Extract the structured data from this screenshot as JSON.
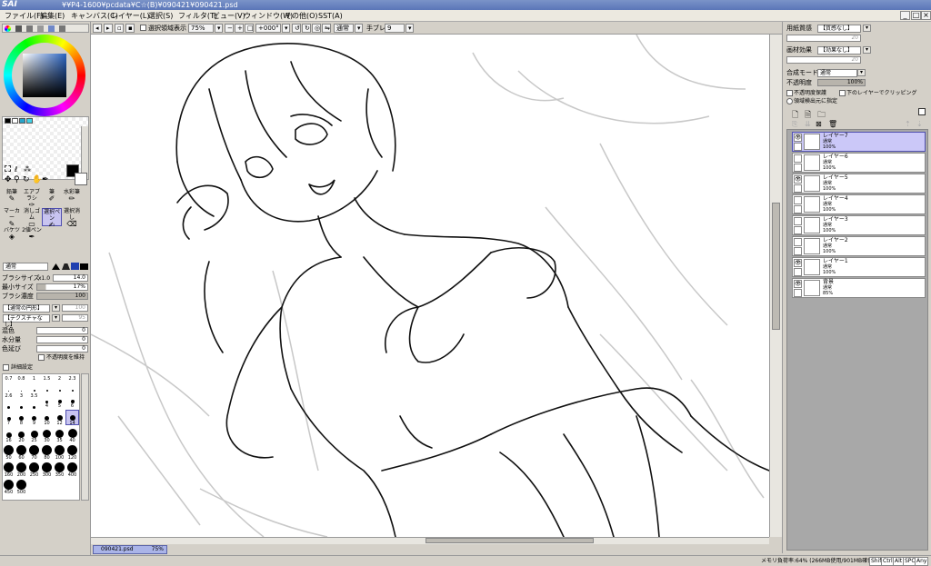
{
  "app": {
    "logo": "SAI",
    "title": "¥¥P4-1600¥pcdata¥C☆(B)¥090421¥090421.psd"
  },
  "menu": [
    "ファイル(F)",
    "編集(E)",
    "キャンバス(C)",
    "レイヤー(L)",
    "選択(S)",
    "フィルタ(T)",
    "ビュー(V)",
    "ウィンドウ(W)",
    "その他(O)",
    "SST(A)"
  ],
  "window_controls": [
    "_",
    "□",
    "×"
  ],
  "toolbar": {
    "selection_display_label": "選択領域表示",
    "zoom": "75%",
    "rotation": "+000°",
    "blend": "通常",
    "stabilizer_label": "手ブレ補正",
    "stabilizer_value": "9"
  },
  "left": {
    "tools_row1": [
      "鉛筆",
      "エアブラシ",
      "筆",
      "水彩筆"
    ],
    "tools_row2": [
      "マーカー",
      "消しゴム",
      "選択ペン",
      "選択消し"
    ],
    "tools_row3": [
      "バケツ",
      "2値ペン"
    ],
    "mode": "通常",
    "brush_size_label": "ブラシサイズ",
    "brush_size_mult": "x1.0",
    "brush_size_value": "14.0",
    "min_size_label": "最小サイズ",
    "min_size_value": "17%",
    "density_label": "ブラシ濃度",
    "density_value": "100",
    "shape_label": "【通常の円形】",
    "shape_value": "100",
    "texture_label": "【テクスチャなし】",
    "texture_value": "95",
    "blend_label": "混色",
    "blend_value": "0",
    "water_label": "水分量",
    "water_value": "0",
    "extend_label": "色延び",
    "extend_value": "0",
    "keep_opacity_label": "不透明度を維持",
    "detail_label": "詳細設定",
    "brush_sizes": [
      "0.7",
      "0.8",
      "1",
      "1.5",
      "2",
      "2.3",
      "2.6",
      "3",
      "3.5",
      "4",
      "5",
      "6",
      "7",
      "8",
      "9",
      "10",
      "12",
      "14",
      "16",
      "20",
      "25",
      "30",
      "35",
      "40",
      "50",
      "60",
      "70",
      "80",
      "100",
      "120",
      "160",
      "200",
      "250",
      "300",
      "350",
      "400",
      "450",
      "500"
    ],
    "swatch_colors": [
      "#000000",
      "#ffffff",
      "#29a3c8",
      "#3fd3e8"
    ]
  },
  "right": {
    "paper_label": "用紙質感",
    "paper_value": "【質感なし】",
    "paper_num": "20",
    "effect_label": "画材効果",
    "effect_value": "【効果なし】",
    "effect_num": "20",
    "composite_label": "合成モード",
    "composite_value": "通常",
    "opacity_label": "不透明度",
    "opacity_value": "100%",
    "protect_label": "不透明度保護",
    "clip_label": "下のレイヤーでクリッピング",
    "sel_source_label": "領域検出元に指定",
    "layers": [
      {
        "name": "レイヤー7",
        "mode": "通常",
        "opacity": "100%",
        "visible": true,
        "selected": true
      },
      {
        "name": "レイヤー6",
        "mode": "通常",
        "opacity": "100%",
        "visible": false,
        "selected": false
      },
      {
        "name": "レイヤー5",
        "mode": "通常",
        "opacity": "100%",
        "visible": true,
        "selected": false
      },
      {
        "name": "レイヤー4",
        "mode": "通常",
        "opacity": "100%",
        "visible": false,
        "selected": false
      },
      {
        "name": "レイヤー3",
        "mode": "通常",
        "opacity": "100%",
        "visible": false,
        "selected": false
      },
      {
        "name": "レイヤー2",
        "mode": "通常",
        "opacity": "100%",
        "visible": false,
        "selected": false
      },
      {
        "name": "レイヤー1",
        "mode": "通常",
        "opacity": "100%",
        "visible": true,
        "selected": false
      },
      {
        "name": "背景",
        "mode": "通常",
        "opacity": "85%",
        "visible": true,
        "selected": false
      }
    ]
  },
  "tab": {
    "name": "090421.psd",
    "zoom": "75%"
  },
  "status": {
    "memory": "メモリ負荷率:64% (266MB使用/901MB確保)",
    "keys": [
      "Shift",
      "Ctrl",
      "Alt",
      "SPC",
      "Any"
    ]
  }
}
